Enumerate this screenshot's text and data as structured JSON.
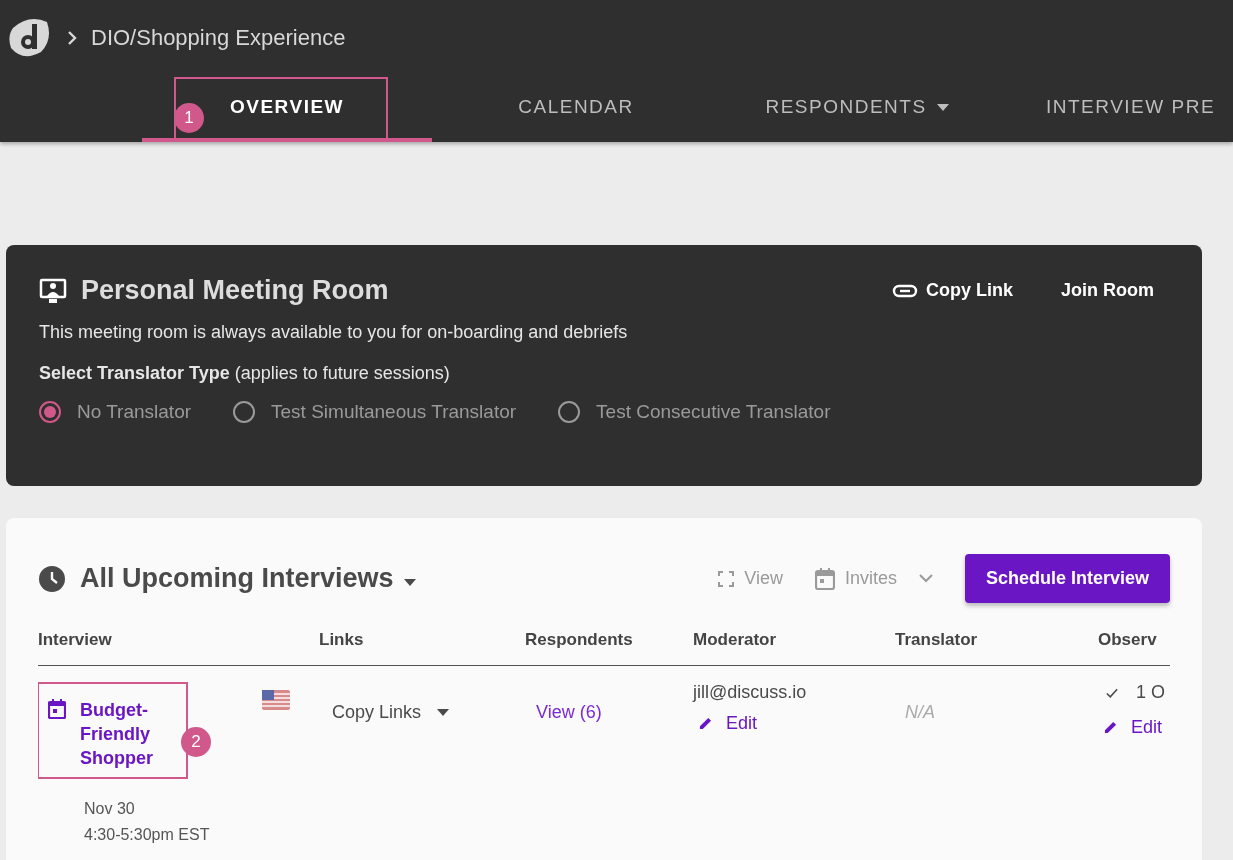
{
  "header": {
    "breadcrumb": "DIO/Shopping Experience"
  },
  "tabs": [
    {
      "label": "OVERVIEW",
      "selected": true,
      "dropdown": false,
      "callout": "1"
    },
    {
      "label": "CALENDAR",
      "selected": false,
      "dropdown": false
    },
    {
      "label": "RESPONDENTS",
      "selected": false,
      "dropdown": true
    },
    {
      "label": "INTERVIEW PRE",
      "selected": false,
      "dropdown": false
    }
  ],
  "meeting_room": {
    "title": "Personal Meeting Room",
    "actions": [
      {
        "label": "Copy Link",
        "kind": "link"
      },
      {
        "label": "Join Room",
        "kind": "plain"
      }
    ],
    "description": "This meeting room is always available to you for on-boarding and debriefs",
    "translator_label": "**Select Translator Type** (applies to future sessions)",
    "options": [
      {
        "label": "No Translator",
        "selected": true
      },
      {
        "label": "Test Simultaneous Translator",
        "selected": false
      },
      {
        "label": "Test Consecutive Translator",
        "selected": false
      }
    ]
  },
  "interviews": {
    "title": "All Upcoming Interviews",
    "view": "View",
    "invites": "Invites",
    "schedule_button": "Schedule Interview",
    "columns": [
      "Interview",
      "Links",
      "Respondents",
      "Moderator",
      "Translator",
      "Observ"
    ],
    "rows": [
      {
        "title": "Budget-Friendly Shopper",
        "date": "Nov 30",
        "time": "4:30-5:30pm EST",
        "links": "Copy Links",
        "respondents": "View (6)",
        "moderator": "jill@discuss.io",
        "moderator_action": "Edit",
        "translator": "N/A",
        "observers": "1 O",
        "observers_action": "Edit",
        "callout": "2"
      }
    ]
  }
}
